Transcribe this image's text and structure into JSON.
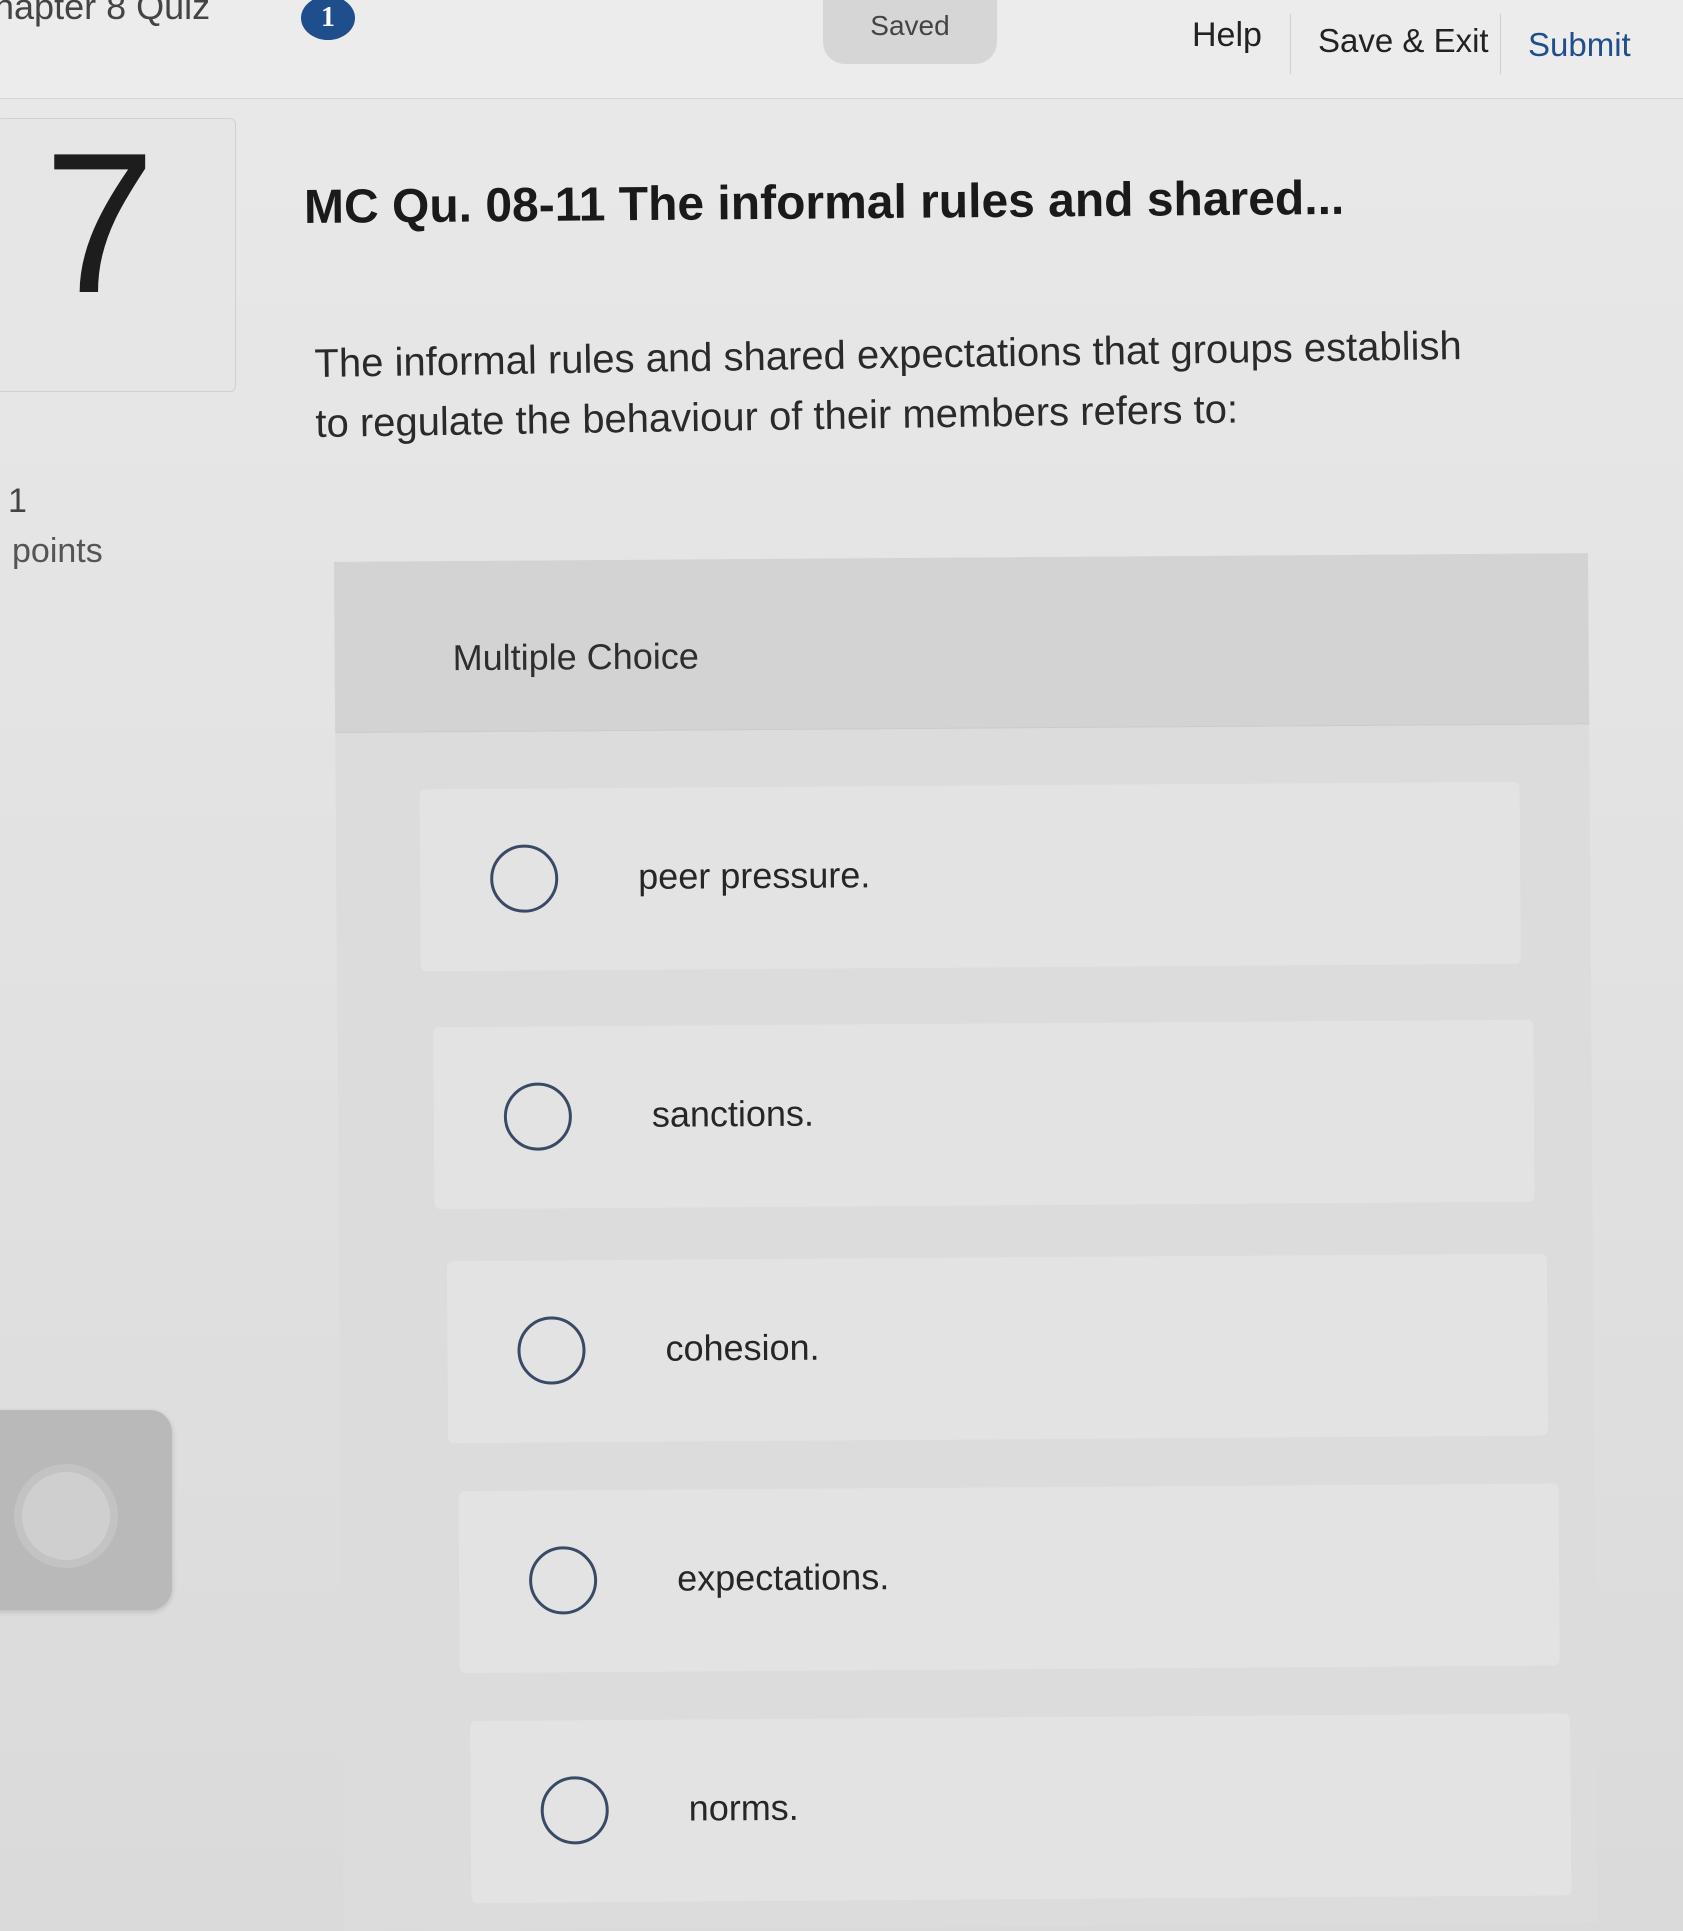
{
  "header": {
    "quiz_title": "hapter 8 Quiz",
    "badge": "1",
    "saved": "Saved",
    "help": "Help",
    "save_exit": "Save & Exit",
    "submit": "Submit"
  },
  "question": {
    "number": "7",
    "points_value": "1",
    "points_label": "points",
    "title": "MC Qu. 08-11 The informal rules and shared...",
    "text": "The informal rules and shared expectations that groups establish to regulate the behaviour of their members refers to:",
    "type_label": "Multiple Choice",
    "choices": [
      {
        "label": "peer pressure."
      },
      {
        "label": "sanctions."
      },
      {
        "label": "cohesion."
      },
      {
        "label": "expectations."
      },
      {
        "label": "norms."
      }
    ]
  },
  "colors": {
    "accent": "#1f4e8c",
    "background": "#e5e5e5"
  },
  "icons": {
    "radio": "radio-circle-icon",
    "badge": "info-badge-icon"
  }
}
